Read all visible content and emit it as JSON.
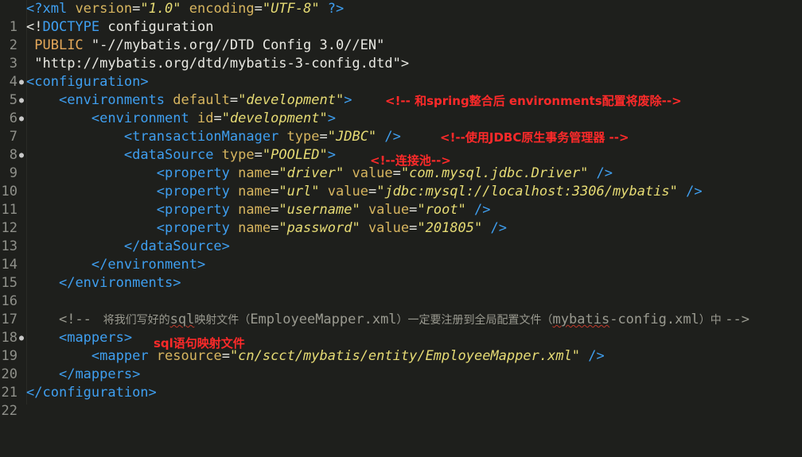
{
  "lines": [
    {
      "n": "1"
    },
    {
      "n": "2"
    },
    {
      "n": "3"
    },
    {
      "n": "4"
    },
    {
      "n": "5"
    },
    {
      "n": "6"
    },
    {
      "n": "7"
    },
    {
      "n": "8"
    },
    {
      "n": "9"
    },
    {
      "n": "10"
    },
    {
      "n": "11"
    },
    {
      "n": "12"
    },
    {
      "n": "13"
    },
    {
      "n": "14"
    },
    {
      "n": "15"
    },
    {
      "n": "16"
    },
    {
      "n": "17"
    },
    {
      "n": "18"
    },
    {
      "n": "19"
    },
    {
      "n": "20"
    },
    {
      "n": "21"
    },
    {
      "n": "22"
    }
  ],
  "code": {
    "l1": {
      "open": "<?",
      "name": "xml",
      "a1": " version",
      "eq1": "=",
      "v1": "\"1.0\"",
      "a2": " encoding",
      "eq2": "=",
      "v2": "\"UTF-8\"",
      "close": " ?>"
    },
    "l2": {
      "open": "<!",
      "name": "DOCTYPE",
      "rest": " configuration"
    },
    "l3": {
      "indent": " ",
      "pub": "PUBLIC",
      "str": " \"-//mybatis.org//DTD Config 3.0//EN\""
    },
    "l4": {
      "indent": " ",
      "str": "\"http://mybatis.org/dtd/mybatis-3-config.dtd\"",
      "close": ">"
    },
    "l5": {
      "open": "<",
      "name": "configuration",
      "close": ">"
    },
    "l6": {
      "indent": "    ",
      "open": "<",
      "name": "environments",
      "a1": " default",
      "eq1": "=",
      "v1": "\"development\"",
      "close": ">"
    },
    "l7": {
      "indent": "        ",
      "open": "<",
      "name": "environment",
      "a1": " id",
      "eq1": "=",
      "v1": "\"development\"",
      "close": ">"
    },
    "l8": {
      "indent": "            ",
      "open": "<",
      "name": "transactionManager",
      "a1": " type",
      "eq1": "=",
      "v1": "\"JDBC\"",
      "close": " />"
    },
    "l9": {
      "indent": "            ",
      "open": "<",
      "name": "dataSource",
      "a1": " type",
      "eq1": "=",
      "v1": "\"POOLED\"",
      "close": ">"
    },
    "l10": {
      "indent": "                ",
      "open": "<",
      "name": "property",
      "a1": " name",
      "eq1": "=",
      "v1": "\"driver\"",
      "a2": " value",
      "eq2": "=",
      "v2": "\"com.mysql.jdbc.Driver\"",
      "close": " />"
    },
    "l11": {
      "indent": "                ",
      "open": "<",
      "name": "property",
      "a1": " name",
      "eq1": "=",
      "v1": "\"url\"",
      "a2": " value",
      "eq2": "=",
      "v2": "\"jdbc:mysql://localhost:3306/mybatis\"",
      "close": " />"
    },
    "l12": {
      "indent": "                ",
      "open": "<",
      "name": "property",
      "a1": " name",
      "eq1": "=",
      "v1": "\"username\"",
      "a2": " value",
      "eq2": "=",
      "v2": "\"root\"",
      "close": " />"
    },
    "l13": {
      "indent": "                ",
      "open": "<",
      "name": "property",
      "a1": " name",
      "eq1": "=",
      "v1": "\"password\"",
      "a2": " value",
      "eq2": "=",
      "v2": "\"201805\"",
      "close": " />"
    },
    "l14": {
      "indent": "            ",
      "open": "</",
      "name": "dataSource",
      "close": ">"
    },
    "l15": {
      "indent": "        ",
      "open": "</",
      "name": "environment",
      "close": ">"
    },
    "l16": {
      "indent": "    ",
      "open": "</",
      "name": "environments",
      "close": ">"
    },
    "l18": {
      "indent": "    ",
      "c1": "<!-- ",
      "c2": " 将我们写好的",
      "c3": "sql",
      "c4": "映射文件（",
      "c5": "EmployeeMapper.xml",
      "c6": "）一定要注册到全局配置文件（",
      "c7": "mybatis",
      "c8": "-config.xml",
      "c9": "）中 ",
      "c10": "-->"
    },
    "l19": {
      "indent": "    ",
      "open": "<",
      "name": "mappers",
      "close": ">"
    },
    "l20": {
      "indent": "        ",
      "open": "<",
      "name": "mapper",
      "a1": " resource",
      "eq1": "=",
      "v1": "\"cn/scct/mybatis/entity/EmployeeMapper.xml\"",
      "close": " />"
    },
    "l21": {
      "indent": "    ",
      "open": "</",
      "name": "mappers",
      "close": ">"
    },
    "l22": {
      "open": "</",
      "name": "configuration",
      "close": ">"
    }
  },
  "annotations": {
    "env_note": "<!-- 和spring整合后 environments配置将废除-->",
    "tx_note": "<!--使用JDBC原生事务管理器 -->",
    "pool_note": "<!--连接池-->",
    "sql_note": "sql语句映射文件"
  },
  "colors": {
    "background": "#1e1f1c",
    "tag": "#3f9ff0",
    "attribute": "#d7b55f",
    "string": "#e6db74",
    "comment": "#9a9a90",
    "annotation": "#ff2a2a"
  }
}
